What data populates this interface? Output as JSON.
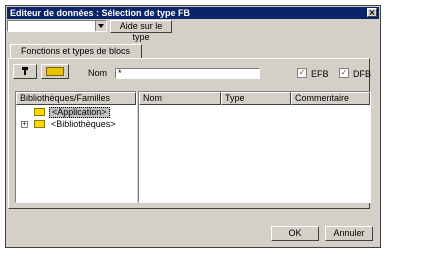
{
  "window": {
    "title": "Editeur de données : Sélection de type FB"
  },
  "top": {
    "combo_value": "",
    "help_button": "Aide sur le type"
  },
  "tab": {
    "label": "Fonctions et types de blocs"
  },
  "toolbar": {
    "filter_icon": "filter-icon",
    "library_icon": "library-icon",
    "nom_label": "Nom",
    "nom_value": "*",
    "efb_label": "EFB",
    "efb_checked": true,
    "dfb_label": "DFB",
    "dfb_checked": true
  },
  "tree": {
    "header": "Bibliothèques/Familles",
    "items": [
      {
        "label": "<Application>",
        "selected": true
      },
      {
        "label": "<Bibliothèques>",
        "selected": false
      }
    ]
  },
  "list": {
    "columns": [
      "Nom",
      "Type",
      "Commentaire"
    ]
  },
  "buttons": {
    "ok": "OK",
    "cancel": "Annuler"
  }
}
